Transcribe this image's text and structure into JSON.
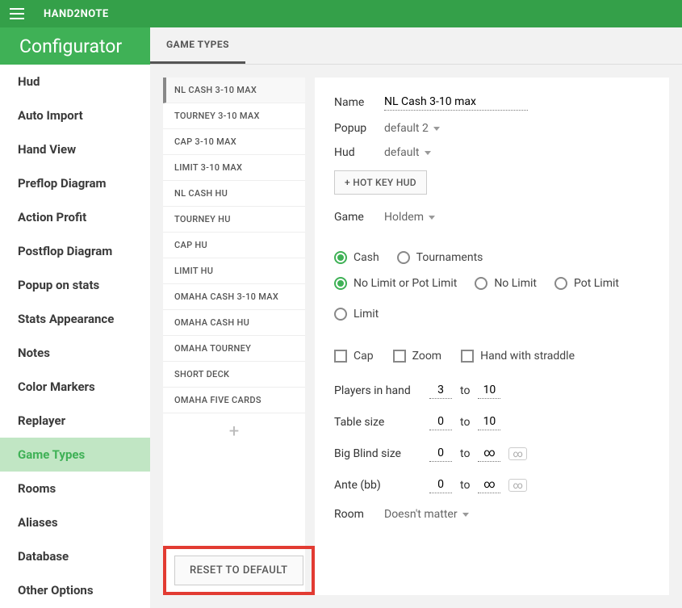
{
  "topbar": {
    "app_title": "HAND2NOTE"
  },
  "header": {
    "title": "Configurator"
  },
  "tabs": [
    {
      "label": "GAME TYPES",
      "active": true
    }
  ],
  "sidebar": {
    "items": [
      {
        "label": "Hud"
      },
      {
        "label": "Auto Import"
      },
      {
        "label": "Hand View"
      },
      {
        "label": "Preflop Diagram"
      },
      {
        "label": "Action Profit"
      },
      {
        "label": "Postflop Diagram"
      },
      {
        "label": "Popup on stats"
      },
      {
        "label": "Stats Appearance"
      },
      {
        "label": "Notes"
      },
      {
        "label": "Color Markers"
      },
      {
        "label": "Replayer"
      },
      {
        "label": "Game Types",
        "active": true
      },
      {
        "label": "Rooms"
      },
      {
        "label": "Aliases"
      },
      {
        "label": "Database"
      },
      {
        "label": "Other Options"
      }
    ]
  },
  "gametype_list": [
    {
      "label": "NL CASH 3-10 MAX",
      "active": true
    },
    {
      "label": "TOURNEY 3-10 MAX"
    },
    {
      "label": "CAP 3-10 MAX"
    },
    {
      "label": "LIMIT 3-10 MAX"
    },
    {
      "label": "NL CASH HU"
    },
    {
      "label": "TOURNEY HU"
    },
    {
      "label": "CAP HU"
    },
    {
      "label": "LIMIT HU"
    },
    {
      "label": "OMAHA CASH 3-10 MAX"
    },
    {
      "label": "OMAHA CASH HU"
    },
    {
      "label": "OMAHA TOURNEY"
    },
    {
      "label": "SHORT DECK"
    },
    {
      "label": "OMAHA FIVE CARDS"
    }
  ],
  "form": {
    "name_label": "Name",
    "name_value": "NL Cash 3-10 max",
    "popup_label": "Popup",
    "popup_value": "default 2",
    "hud_label": "Hud",
    "hud_value": "default",
    "hotkey_btn": "+ HOT KEY HUD",
    "game_label": "Game",
    "game_value": "Holdem",
    "mode_options": [
      {
        "label": "Cash",
        "selected": true
      },
      {
        "label": "Tournaments",
        "selected": false
      }
    ],
    "limit_options": [
      {
        "label": "No Limit or Pot Limit",
        "selected": true
      },
      {
        "label": "No Limit",
        "selected": false
      },
      {
        "label": "Pot Limit",
        "selected": false
      },
      {
        "label": "Limit",
        "selected": false
      }
    ],
    "flags": [
      {
        "label": "Cap",
        "checked": false
      },
      {
        "label": "Zoom",
        "checked": false
      },
      {
        "label": "Hand with straddle",
        "checked": false
      }
    ],
    "players_label": "Players in hand",
    "players_from": "3",
    "players_to": "10",
    "table_label": "Table size",
    "table_from": "0",
    "table_to": "10",
    "bb_label": "Big Blind size",
    "bb_from": "0",
    "bb_to": "∞",
    "ante_label": "Ante (bb)",
    "ante_from": "0",
    "ante_to": "∞",
    "to_word": "to",
    "inf_box": "∞",
    "room_label": "Room",
    "room_value": "Doesn't matter"
  },
  "reset_label": "RESET TO DEFAULT",
  "add_icon": "+"
}
